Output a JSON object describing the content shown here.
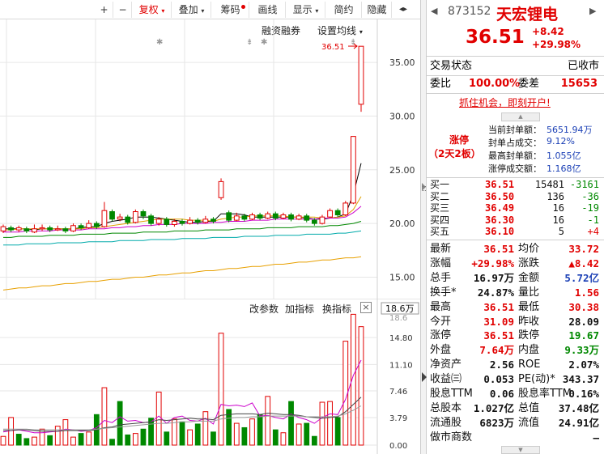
{
  "toolbar": {
    "plus": "+",
    "minus": "−",
    "restore_rights": "复权",
    "overlay": "叠加",
    "chip": "筹码",
    "draw_line": "画线",
    "display": "显示",
    "simplified": "简约",
    "hide": "隐藏",
    "scroll_arrows": "◂▸"
  },
  "chart_header": {
    "margin_trading": "融资融券",
    "set_ma": "设置均线",
    "price_marker": "36.51"
  },
  "price_axis": [
    "35.00",
    "30.00",
    "25.00",
    "20.00",
    "15.00"
  ],
  "volume_axis": [
    "18.6万",
    "14.80",
    "11.10",
    "7.46",
    "3.79",
    "0.00"
  ],
  "volume_axis_top_clipped": "18.6",
  "sub_toolbar": {
    "edit_params": "改参数",
    "add_indicator": "加指标",
    "switch_indicator": "换指标",
    "close": "×"
  },
  "chart_data": [
    {
      "type": "candlestick",
      "title": "",
      "ylim": [
        13.0,
        39.0
      ],
      "yticks": [
        35,
        30,
        25,
        20,
        15
      ],
      "candles": [
        {
          "o": 19.3,
          "c": 19.7,
          "h": 19.9,
          "l": 19.1
        },
        {
          "o": 19.6,
          "c": 19.4,
          "h": 19.8,
          "l": 19.2
        },
        {
          "o": 19.4,
          "c": 19.6,
          "h": 19.8,
          "l": 19.2
        },
        {
          "o": 19.5,
          "c": 19.3,
          "h": 19.7,
          "l": 19.1
        },
        {
          "o": 19.2,
          "c": 19.5,
          "h": 19.9,
          "l": 19.1
        },
        {
          "o": 19.5,
          "c": 19.6,
          "h": 19.9,
          "l": 19.3
        },
        {
          "o": 19.6,
          "c": 19.4,
          "h": 19.8,
          "l": 19.2
        },
        {
          "o": 19.4,
          "c": 19.5,
          "h": 19.8,
          "l": 19.3
        },
        {
          "o": 19.5,
          "c": 19.3,
          "h": 19.7,
          "l": 19.1
        },
        {
          "o": 19.3,
          "c": 19.8,
          "h": 20.0,
          "l": 19.2
        },
        {
          "o": 19.8,
          "c": 19.6,
          "h": 20.0,
          "l": 19.4
        },
        {
          "o": 19.6,
          "c": 20.0,
          "h": 20.3,
          "l": 19.5
        },
        {
          "o": 20.0,
          "c": 19.7,
          "h": 20.2,
          "l": 19.5
        },
        {
          "o": 19.7,
          "c": 21.2,
          "h": 22.0,
          "l": 19.6
        },
        {
          "o": 21.1,
          "c": 20.4,
          "h": 21.3,
          "l": 20.2
        },
        {
          "o": 20.4,
          "c": 20.6,
          "h": 20.9,
          "l": 20.2
        },
        {
          "o": 20.6,
          "c": 20.1,
          "h": 20.8,
          "l": 19.9
        },
        {
          "o": 20.1,
          "c": 21.1,
          "h": 21.3,
          "l": 20.0
        },
        {
          "o": 21.1,
          "c": 20.7,
          "h": 21.3,
          "l": 20.4
        },
        {
          "o": 20.7,
          "c": 20.0,
          "h": 20.9,
          "l": 19.8
        },
        {
          "o": 20.0,
          "c": 20.4,
          "h": 20.6,
          "l": 19.8
        },
        {
          "o": 20.4,
          "c": 19.9,
          "h": 20.6,
          "l": 19.7
        },
        {
          "o": 19.9,
          "c": 20.2,
          "h": 20.4,
          "l": 19.7
        },
        {
          "o": 20.2,
          "c": 20.0,
          "h": 20.4,
          "l": 19.8
        },
        {
          "o": 20.0,
          "c": 20.3,
          "h": 20.6,
          "l": 19.9
        },
        {
          "o": 20.3,
          "c": 20.1,
          "h": 20.5,
          "l": 19.9
        },
        {
          "o": 20.1,
          "c": 20.4,
          "h": 20.7,
          "l": 20.0
        },
        {
          "o": 20.4,
          "c": 20.2,
          "h": 20.6,
          "l": 20.0
        },
        {
          "o": 22.4,
          "c": 23.9,
          "h": 24.2,
          "l": 22.2
        },
        {
          "o": 21.0,
          "c": 20.3,
          "h": 21.2,
          "l": 20.1
        },
        {
          "o": 20.3,
          "c": 20.7,
          "h": 21.0,
          "l": 20.2
        },
        {
          "o": 20.7,
          "c": 20.4,
          "h": 20.9,
          "l": 20.2
        },
        {
          "o": 20.4,
          "c": 20.8,
          "h": 21.0,
          "l": 20.3
        },
        {
          "o": 20.8,
          "c": 20.5,
          "h": 21.0,
          "l": 20.3
        },
        {
          "o": 20.5,
          "c": 20.9,
          "h": 21.1,
          "l": 20.4
        },
        {
          "o": 20.9,
          "c": 20.5,
          "h": 21.1,
          "l": 20.3
        },
        {
          "o": 20.5,
          "c": 20.8,
          "h": 21.0,
          "l": 20.4
        },
        {
          "o": 20.8,
          "c": 20.4,
          "h": 21.0,
          "l": 20.2
        },
        {
          "o": 20.4,
          "c": 20.7,
          "h": 20.9,
          "l": 20.3
        },
        {
          "o": 20.7,
          "c": 20.3,
          "h": 20.9,
          "l": 20.1
        },
        {
          "o": 20.3,
          "c": 20.0,
          "h": 20.5,
          "l": 19.8
        },
        {
          "o": 20.0,
          "c": 20.6,
          "h": 20.8,
          "l": 19.9
        },
        {
          "o": 20.6,
          "c": 21.2,
          "h": 21.4,
          "l": 20.5
        },
        {
          "o": 21.2,
          "c": 20.8,
          "h": 21.4,
          "l": 20.6
        },
        {
          "o": 20.8,
          "c": 21.9,
          "h": 22.1,
          "l": 20.7
        },
        {
          "o": 21.9,
          "c": 28.1,
          "h": 28.1,
          "l": 21.8
        },
        {
          "o": 31.1,
          "c": 36.5,
          "h": 36.5,
          "l": 30.4
        }
      ],
      "moving_averages": [
        {
          "color": "#000000",
          "values": [
            19.5,
            19.5,
            19.5,
            19.5,
            19.4,
            19.5,
            19.5,
            19.5,
            19.5,
            19.5,
            19.6,
            19.7,
            19.7,
            20.0,
            20.2,
            20.3,
            20.4,
            20.6,
            20.6,
            20.6,
            20.5,
            20.4,
            20.3,
            20.2,
            20.1,
            20.1,
            20.2,
            20.2,
            20.9,
            20.9,
            20.9,
            20.8,
            20.6,
            20.6,
            20.6,
            20.6,
            20.6,
            20.6,
            20.6,
            20.5,
            20.4,
            20.4,
            20.5,
            20.6,
            20.9,
            22.7,
            25.6
          ]
        },
        {
          "color": "#e0a000",
          "values": [
            19.4,
            19.4,
            19.5,
            19.5,
            19.5,
            19.5,
            19.5,
            19.5,
            19.5,
            19.5,
            19.5,
            19.6,
            19.6,
            19.7,
            19.8,
            19.9,
            20.0,
            20.1,
            20.2,
            20.3,
            20.4,
            20.4,
            20.4,
            20.4,
            20.3,
            20.3,
            20.3,
            20.2,
            20.4,
            20.5,
            20.6,
            20.6,
            20.7,
            20.7,
            20.7,
            20.7,
            20.7,
            20.6,
            20.6,
            20.6,
            20.6,
            20.5,
            20.5,
            20.6,
            20.7,
            21.3,
            22.5
          ]
        },
        {
          "color": "#cc00cc",
          "values": [
            19.2,
            19.2,
            19.2,
            19.3,
            19.3,
            19.3,
            19.3,
            19.4,
            19.4,
            19.4,
            19.4,
            19.5,
            19.5,
            19.5,
            19.6,
            19.6,
            19.7,
            19.7,
            19.8,
            19.8,
            19.9,
            19.9,
            19.9,
            20.0,
            20.0,
            20.0,
            20.0,
            20.1,
            20.1,
            20.2,
            20.2,
            20.2,
            20.3,
            20.3,
            20.3,
            20.4,
            20.4,
            20.4,
            20.4,
            20.4,
            20.4,
            20.5,
            20.5,
            20.5,
            20.6,
            21.0,
            21.6
          ]
        },
        {
          "color": "#008800",
          "values": [
            18.7,
            18.7,
            18.8,
            18.8,
            18.8,
            18.8,
            18.9,
            18.9,
            18.9,
            18.9,
            19.0,
            19.0,
            19.0,
            19.0,
            19.1,
            19.1,
            19.1,
            19.1,
            19.2,
            19.2,
            19.2,
            19.2,
            19.3,
            19.3,
            19.3,
            19.3,
            19.4,
            19.4,
            19.4,
            19.4,
            19.5,
            19.5,
            19.5,
            19.5,
            19.6,
            19.6,
            19.6,
            19.6,
            19.7,
            19.7,
            19.7,
            19.7,
            19.8,
            19.8,
            19.9,
            20.0,
            20.2
          ]
        },
        {
          "color": "#00aaaa",
          "values": [
            18.0,
            18.0,
            18.0,
            18.1,
            18.1,
            18.1,
            18.1,
            18.2,
            18.2,
            18.2,
            18.2,
            18.3,
            18.3,
            18.3,
            18.3,
            18.4,
            18.4,
            18.4,
            18.4,
            18.5,
            18.5,
            18.5,
            18.5,
            18.6,
            18.6,
            18.6,
            18.6,
            18.7,
            18.7,
            18.7,
            18.7,
            18.8,
            18.8,
            18.8,
            18.8,
            18.9,
            18.9,
            18.9,
            18.9,
            19.0,
            19.0,
            19.0,
            19.0,
            19.1,
            19.1,
            19.2,
            19.3
          ]
        },
        {
          "color": "#e8a000",
          "values": [
            13.8,
            13.9,
            14.0,
            14.0,
            14.1,
            14.2,
            14.2,
            14.3,
            14.4,
            14.4,
            14.5,
            14.6,
            14.6,
            14.7,
            14.8,
            14.8,
            14.9,
            15.0,
            15.0,
            15.1,
            15.2,
            15.2,
            15.3,
            15.4,
            15.4,
            15.5,
            15.6,
            15.6,
            15.7,
            15.8,
            15.8,
            15.9,
            16.0,
            16.0,
            16.1,
            16.2,
            16.2,
            16.3,
            16.4,
            16.4,
            16.5,
            16.6,
            16.6,
            16.7,
            16.8,
            16.8,
            16.9
          ]
        }
      ],
      "last_price_marker": 36.51
    },
    {
      "type": "bar",
      "title": "",
      "ylim": [
        0,
        18.6
      ],
      "yticks": [
        14.8,
        11.1,
        7.46,
        3.79,
        0.0
      ],
      "values": [
        1.2,
        3.8,
        1.5,
        0.9,
        1.1,
        2.2,
        1.3,
        2.6,
        3.5,
        1.1,
        1.6,
        1.8,
        4.2,
        7.9,
        0.8,
        6.0,
        1.4,
        1.6,
        2.2,
        3.7,
        7.3,
        1.8,
        3.6,
        3.2,
        2.1,
        2.9,
        4.6,
        1.8,
        15.4,
        4.9,
        3.0,
        2.4,
        3.6,
        4.2,
        6.7,
        2.1,
        1.7,
        6.0,
        2.9,
        3.0,
        1.2,
        5.9,
        6.0,
        3.8,
        14.3,
        18.0,
        16.3
      ],
      "up": [
        true,
        true,
        false,
        false,
        true,
        true,
        false,
        true,
        true,
        true,
        false,
        true,
        false,
        true,
        false,
        false,
        false,
        true,
        false,
        false,
        true,
        false,
        true,
        false,
        true,
        false,
        true,
        false,
        true,
        false,
        true,
        false,
        true,
        false,
        true,
        false,
        true,
        false,
        true,
        false,
        false,
        true,
        true,
        false,
        true,
        true,
        true
      ],
      "lines": [
        {
          "color": "#cc00cc",
          "values": [
            1.8,
            2.0,
            2.1,
            1.9,
            1.7,
            1.7,
            1.8,
            1.9,
            2.2,
            2.1,
            1.9,
            2.0,
            2.4,
            3.4,
            3.1,
            3.9,
            3.3,
            3.4,
            3.1,
            3.2,
            4.0,
            3.0,
            3.8,
            4.0,
            3.4,
            3.3,
            3.7,
            2.9,
            5.6,
            5.4,
            5.5,
            5.3,
            5.8,
            4.0,
            4.1,
            3.8,
            3.6,
            4.3,
            3.8,
            3.5,
            3.0,
            3.8,
            4.3,
            4.2,
            6.3,
            9.6,
            11.7
          ]
        },
        {
          "color": "#444444",
          "values": [
            2.0,
            2.0,
            2.1,
            2.1,
            2.0,
            1.9,
            1.9,
            1.9,
            2.0,
            2.0,
            2.0,
            2.0,
            2.1,
            2.4,
            2.5,
            2.8,
            2.9,
            3.0,
            3.1,
            3.2,
            3.5,
            3.4,
            3.5,
            3.6,
            3.7,
            3.6,
            3.6,
            3.5,
            4.1,
            4.2,
            4.3,
            4.3,
            4.3,
            4.2,
            4.4,
            4.3,
            4.2,
            4.2,
            4.1,
            3.9,
            3.8,
            3.7,
            3.8,
            3.9,
            4.6,
            5.6,
            6.6
          ]
        },
        {
          "color": "#999999",
          "values": [
            2.2,
            2.2,
            2.2,
            2.2,
            2.1,
            2.1,
            2.1,
            2.1,
            2.1,
            2.1,
            2.1,
            2.1,
            2.2,
            2.3,
            2.4,
            2.5,
            2.6,
            2.7,
            2.8,
            2.9,
            3.0,
            3.0,
            3.1,
            3.2,
            3.2,
            3.3,
            3.3,
            3.3,
            3.6,
            3.7,
            3.8,
            3.8,
            3.9,
            3.9,
            4.0,
            4.0,
            4.0,
            4.0,
            4.0,
            3.9,
            3.9,
            3.9,
            3.9,
            4.0,
            4.3,
            4.8,
            5.4
          ]
        }
      ]
    }
  ],
  "quote": {
    "code": "873152",
    "name": "天宏锂电",
    "price": "36.51",
    "change": "+8.42",
    "change_pct": "+29.98%",
    "trade_status_label": "交易状态",
    "trade_status_value": "已收市",
    "weibi_label": "委比",
    "weibi_value": "100.00%",
    "weicha_label": "委差",
    "weicha_value": "15653",
    "promo_link": "抓住机会，即刻开户!",
    "limit_title": "涨停",
    "limit_subtitle": "（2天2板）",
    "seal_items": [
      {
        "label": "当前封单额：",
        "value": "5651.94万"
      },
      {
        "label": "封单占成交：",
        "value": "9.12%"
      },
      {
        "label": "最高封单额：",
        "value": "1.055亿"
      },
      {
        "label": "涨停成交额：",
        "value": "1.168亿"
      }
    ],
    "bids": [
      {
        "label": "买一",
        "price": "36.51",
        "vol": "15481",
        "chg": "-3161"
      },
      {
        "label": "买二",
        "price": "36.50",
        "vol": "136",
        "chg": "-36"
      },
      {
        "label": "买三",
        "price": "36.49",
        "vol": "16",
        "chg": "-19"
      },
      {
        "label": "买四",
        "price": "36.30",
        "vol": "16",
        "chg": "-1"
      },
      {
        "label": "买五",
        "price": "36.10",
        "vol": "5",
        "chg": "+4"
      }
    ],
    "stats": [
      {
        "l1": "最新",
        "v1": "36.51",
        "c1": "red",
        "l2": "均价",
        "v2": "33.72",
        "c2": "red"
      },
      {
        "l1": "涨幅",
        "v1": "+29.98%",
        "c1": "red",
        "l2": "涨跌",
        "v2": "▲8.42",
        "c2": "red"
      },
      {
        "l1": "总手",
        "v1": "16.97万",
        "c1": "black",
        "l2": "金额",
        "v2": "5.72亿",
        "c2": "blue"
      },
      {
        "l1": "换手*",
        "v1": "24.87%",
        "c1": "black",
        "l2": "量比",
        "v2": "1.56",
        "c2": "red"
      },
      {
        "l1": "最高",
        "v1": "36.51",
        "c1": "red",
        "l2": "最低",
        "v2": "30.38",
        "c2": "red"
      },
      {
        "l1": "今开",
        "v1": "31.09",
        "c1": "red",
        "l2": "昨收",
        "v2": "28.09",
        "c2": "black"
      },
      {
        "l1": "涨停",
        "v1": "36.51",
        "c1": "red",
        "l2": "跌停",
        "v2": "19.67",
        "c2": "green"
      },
      {
        "l1": "外盘",
        "v1": "7.64万",
        "c1": "red",
        "l2": "内盘",
        "v2": "9.33万",
        "c2": "green"
      },
      {
        "l1": "净资产",
        "v1": "2.56",
        "c1": "black",
        "l2": "ROE",
        "v2": "2.07%",
        "c2": "black"
      },
      {
        "l1": "收益㈢",
        "v1": "0.053",
        "c1": "black",
        "l2": "PE(动)*",
        "v2": "343.37",
        "c2": "black"
      },
      {
        "l1": "股息TTM",
        "v1": "0.06",
        "c1": "black",
        "l2": "股息率TTM",
        "v2": "0.16%",
        "c2": "black"
      },
      {
        "l1": "总股本",
        "v1": "1.027亿",
        "c1": "black",
        "l2": "总值",
        "v2": "37.48亿",
        "c2": "black"
      },
      {
        "l1": "流通股",
        "v1": "6823万",
        "c1": "black",
        "l2": "流值",
        "v2": "24.91亿",
        "c2": "black"
      },
      {
        "l1": "做市商数",
        "v1": "",
        "c1": "black",
        "l2": "",
        "v2": "—",
        "c2": "black"
      }
    ]
  },
  "colors": {
    "up": "#e10000",
    "down": "#008800",
    "grid": "#e6e6e6",
    "accent_blue": "#1a3fb5"
  }
}
